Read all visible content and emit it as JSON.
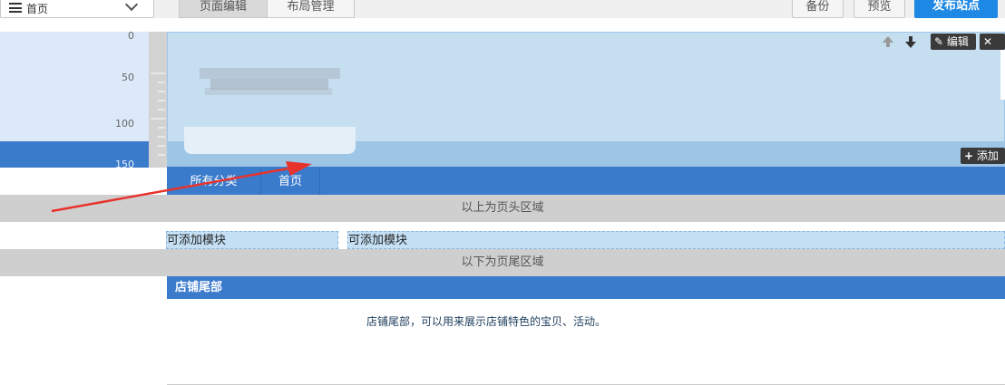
{
  "toolbar": {
    "page_select": "首页",
    "tabs": [
      "页面编辑",
      "布局管理"
    ],
    "backup": "备份",
    "preview": "预览",
    "publish": "发布站点"
  },
  "ruler": {
    "labels": [
      "0",
      "50",
      "100",
      "150"
    ]
  },
  "header_tools": {
    "edit": "编辑",
    "add_module": "添加"
  },
  "nav": {
    "items": [
      "所有分类",
      "首页"
    ]
  },
  "regions": {
    "above_header": "以上为页头区域",
    "below_footer": "以下为页尾区域"
  },
  "modules": {
    "slot_left": "可添加模块",
    "slot_right": "可添加模块"
  },
  "footer": {
    "title": "店铺尾部",
    "description": "店铺尾部，可以用来展示店铺特色的宝贝、活动。"
  },
  "colors": {
    "accent": "#3b7bcc",
    "publish": "#1e88e5",
    "annotation_arrow": "#e8322c"
  }
}
